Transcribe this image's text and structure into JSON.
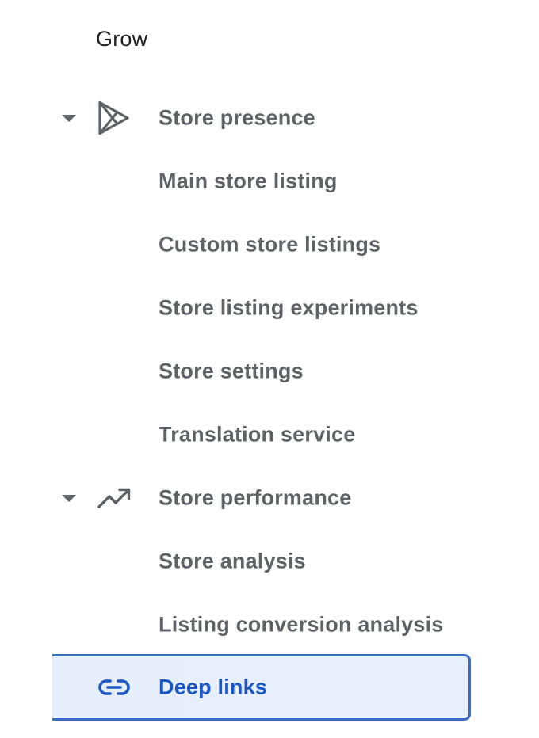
{
  "section": {
    "title": "Grow"
  },
  "nav": {
    "store_presence": {
      "label": "Store presence",
      "icon": "play-store-icon",
      "expanded": true,
      "children": [
        "Main store listing",
        "Custom store listings",
        "Store listing experiments",
        "Store settings",
        "Translation service"
      ]
    },
    "store_performance": {
      "label": "Store performance",
      "icon": "trending-up-icon",
      "expanded": true,
      "children": [
        "Store analysis",
        "Listing conversion analysis"
      ]
    },
    "deep_links": {
      "label": "Deep links",
      "icon": "link-icon",
      "selected": true
    }
  },
  "colors": {
    "text_primary": "#202124",
    "text_secondary": "#5f6368",
    "accent": "#1a56c4",
    "active_border": "#3b6cc6",
    "active_bg": "#e8f0fe"
  }
}
